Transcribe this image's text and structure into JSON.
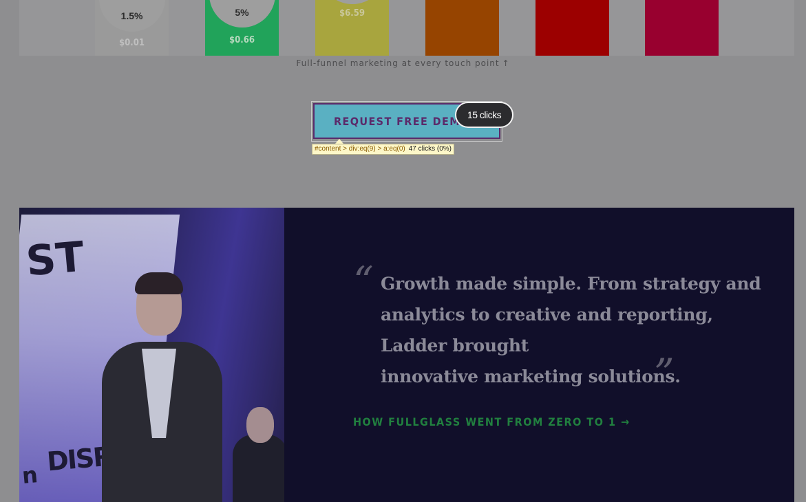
{
  "funnel": {
    "caption": "Full-funnel marketing at every touch point",
    "caption_arrow": "↑",
    "bars": [
      {
        "percent": "1.5%",
        "price": "$0.01",
        "color": "#9a9a9a"
      },
      {
        "percent": "5%",
        "price": "$0.66",
        "color": "#21a35a"
      },
      {
        "percent": "",
        "price": "$6.59",
        "color": "#a8a53e"
      },
      {
        "percent": "",
        "price": "",
        "color": "#964400"
      },
      {
        "percent": "",
        "price": "",
        "color": "#9c0000"
      },
      {
        "percent": "",
        "price": "",
        "color": "#98002f"
      }
    ]
  },
  "cta": {
    "label": "REQUEST FREE DEMO",
    "click_badge": "15 clicks",
    "selector": "#content > div:eq(9) > a:eq(0)",
    "selector_stats": "47 clicks (0%)"
  },
  "testimonial": {
    "open_quote": "“",
    "close_quote": "”",
    "lines": [
      "Growth made simple. From strategy and",
      "analytics to creative and reporting,",
      "Ladder brought",
      "innovative marketing solutions."
    ],
    "link": "HOW FULLGLASS WENT FROM ZERO TO 1 →",
    "photo_text": {
      "banner_top": "ST",
      "banner_bottom_1": "DISRUPT",
      "banner_bottom_2": "n"
    }
  },
  "colors": {
    "page_overlay": "#8e8e90",
    "testimonial_bg": "#110f2a",
    "cta_bg": "#5ab0c2",
    "cta_text": "#5b2a6a",
    "link": "#21803f"
  }
}
